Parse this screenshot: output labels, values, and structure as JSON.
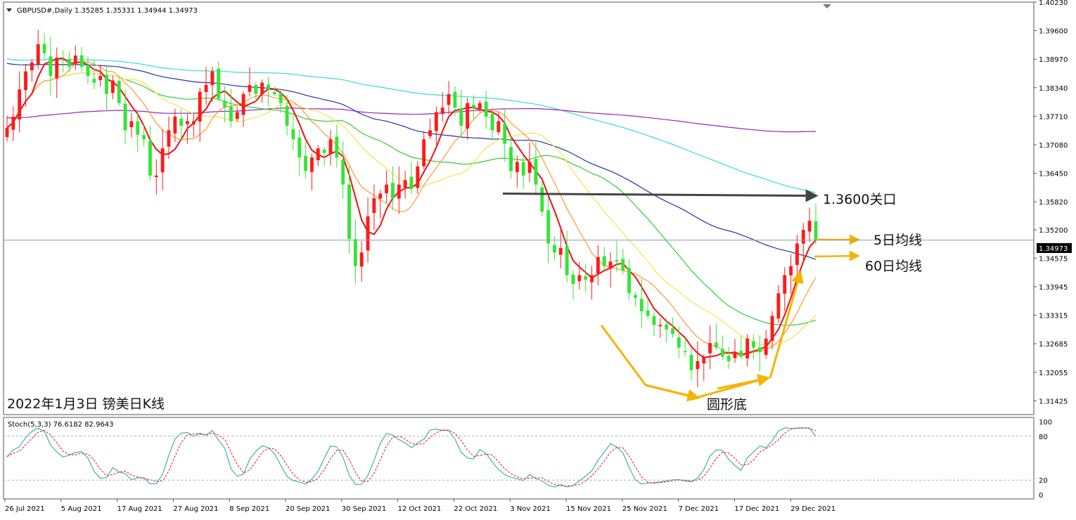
{
  "header": {
    "symbol_line": "GBPUSD#,Daily  1.35285 1.35331 1.34944 1.34973",
    "stoch_line": "Stoch(5,3,3) 76.6182 82.9643",
    "current_price": "1.34973"
  },
  "annotations": {
    "chart_caption": "2022年1月3日 镑美日K线",
    "level_label": "1.3600关口",
    "ma5_label": "5日均线",
    "ma60_label": "60日均线",
    "pattern_label": "圆形底"
  },
  "colors": {
    "bull": "#ff1a1a",
    "bear": "#33e633",
    "ma5": "#ee1111",
    "ma10": "#ff9933",
    "ma20": "#f5e34a",
    "ma30": "#33cc33",
    "ma60": "#2233aa",
    "ma120": "#33dddd",
    "ma250": "#9922bb",
    "stoch_main": "#40b0b0",
    "stoch_signal": "#ee1111",
    "arrow": "#f5b400",
    "level_arrow": "#444444"
  },
  "chart_data": [
    {
      "type": "candlestick",
      "symbol": "GBPUSD#",
      "timeframe": "Daily",
      "y_ticks": [
        "1.40230",
        "1.39600",
        "1.38970",
        "1.38340",
        "1.37710",
        "1.37080",
        "1.36450",
        "1.35820",
        "1.35200",
        "1.34575",
        "1.33945",
        "1.33315",
        "1.32685",
        "1.32055",
        "1.31425"
      ],
      "ylim": [
        1.3112,
        1.4023
      ],
      "x_ticks": [
        "26 Jul 2021",
        "5 Aug 2021",
        "17 Aug 2021",
        "27 Aug 2021",
        "8 Sep 2021",
        "20 Sep 2021",
        "30 Sep 2021",
        "12 Oct 2021",
        "22 Oct 2021",
        "3 Nov 2021",
        "15 Nov 2021",
        "25 Nov 2021",
        "7 Dec 2021",
        "17 Dec 2021",
        "29 Dec 2021"
      ],
      "candles_close": [
        1.3745,
        1.377,
        1.383,
        1.387,
        1.389,
        1.393,
        1.391,
        1.386,
        1.39,
        1.3895,
        1.388,
        1.3905,
        1.388,
        1.386,
        1.3845,
        1.386,
        1.382,
        1.385,
        1.38,
        1.374,
        1.376,
        1.373,
        1.372,
        1.364,
        1.364,
        1.37,
        1.374,
        1.377,
        1.375,
        1.376,
        1.376,
        1.3825,
        1.384,
        1.387,
        1.381,
        1.379,
        1.376,
        1.378,
        1.382,
        1.384,
        1.382,
        1.3845,
        1.383,
        1.382,
        1.38,
        1.375,
        1.372,
        1.368,
        1.365,
        1.368,
        1.37,
        1.369,
        1.372,
        1.368,
        1.362,
        1.35,
        1.344,
        1.347,
        1.355,
        1.359,
        1.36,
        1.362,
        1.359,
        1.362,
        1.363,
        1.361,
        1.366,
        1.372,
        1.374,
        1.378,
        1.379,
        1.382,
        1.379,
        1.375,
        1.38,
        1.379,
        1.38,
        1.377,
        1.374,
        1.376,
        1.371,
        1.365,
        1.367,
        1.364,
        1.367,
        1.362,
        1.356,
        1.349,
        1.347,
        1.348,
        1.342,
        1.34,
        1.342,
        1.341,
        1.342,
        1.346,
        1.344,
        1.345,
        1.345,
        1.343,
        1.338,
        1.337,
        1.334,
        1.333,
        1.331,
        1.331,
        1.33,
        1.329,
        1.326,
        1.325,
        1.321,
        1.323,
        1.324,
        1.327,
        1.326,
        1.324,
        1.323,
        1.325,
        1.324,
        1.328,
        1.326,
        1.325,
        1.328,
        1.333,
        1.338,
        1.342,
        1.344,
        1.349,
        1.352,
        1.354,
        1.3497
      ]
    },
    {
      "type": "line",
      "name": "Stoch(5,3,3)",
      "values_shown": [
        "76.6182",
        "82.9643"
      ],
      "y_ticks": [
        "100",
        "80",
        "20",
        "0"
      ],
      "levels": [
        80,
        20
      ],
      "ylim": [
        0,
        100
      ]
    }
  ]
}
